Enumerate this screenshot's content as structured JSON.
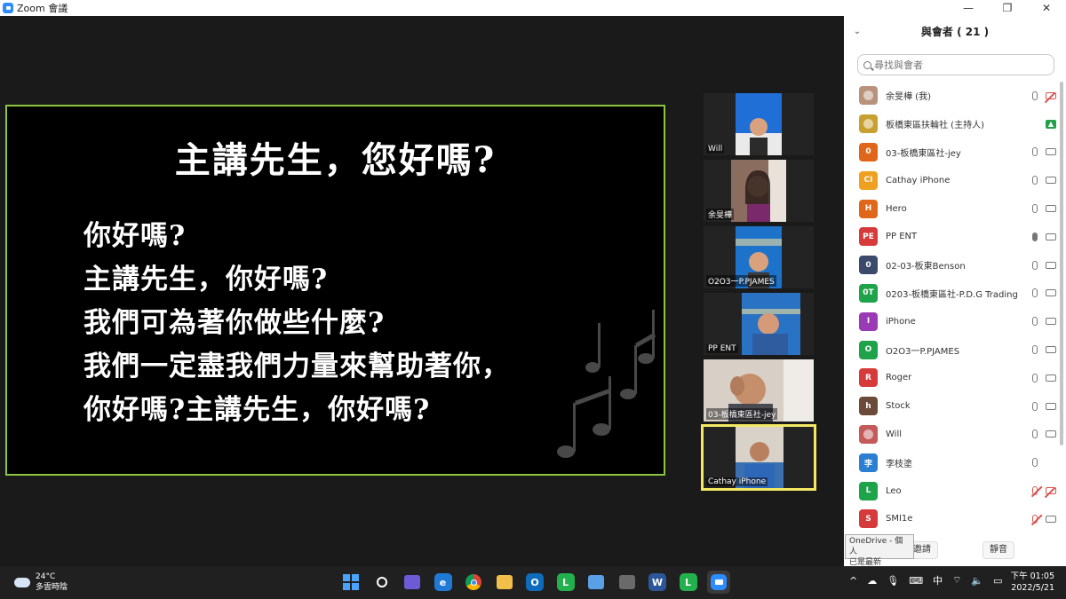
{
  "window": {
    "title": "Zoom 會議",
    "minimize": "—",
    "maximize": "❐",
    "close": "✕"
  },
  "share": {
    "heading": "主講先生，您好嗎?",
    "lines": [
      "你好嗎?",
      "主講先生，你好嗎?",
      "我們可為著你做些什麼?",
      "我們一定盡我們力量來幫助著你，",
      "你好嗎?主講先生，你好嗎?"
    ]
  },
  "tiles": [
    {
      "name": "Will",
      "color": "#1f6fd6"
    },
    {
      "name": "余旻樺",
      "color": "#9b7e6b"
    },
    {
      "name": "O2O3一P.PJAMES",
      "color": "#1d72c9"
    },
    {
      "name": "PP ENT",
      "color": "#2a73c4"
    },
    {
      "name": "03-板橋東區社-jey",
      "color": "#b58a6d"
    },
    {
      "name": "Cathay iPhone",
      "color": "#3a6fb0"
    }
  ],
  "participants_panel": {
    "title": "與會者 ( 21 )",
    "search_placeholder": "尋找與會者",
    "participants": [
      {
        "name": "余旻樺 (我)",
        "avatar": "",
        "color": "#b9927c",
        "mic": "off",
        "cam": "muted"
      },
      {
        "name": "板橋東區扶輪社 (主持人)",
        "avatar": "",
        "color": "#c8a030",
        "mic": "none",
        "cam": "host"
      },
      {
        "name": "03-板橋東區社-jey",
        "avatar": "0",
        "color": "#e0661a",
        "mic": "off",
        "cam": "off"
      },
      {
        "name": "Cathay iPhone",
        "avatar": "CI",
        "color": "#f0a020",
        "mic": "off",
        "cam": "off"
      },
      {
        "name": "Hero",
        "avatar": "H",
        "color": "#e0661a",
        "mic": "off",
        "cam": "off"
      },
      {
        "name": "PP ENT",
        "avatar": "PE",
        "color": "#d63a3a",
        "mic": "on",
        "cam": "off"
      },
      {
        "name": "02-03-板東Benson",
        "avatar": "0",
        "color": "#3b4a6b",
        "mic": "off",
        "cam": "off"
      },
      {
        "name": "0203-板橋東區社-P.D.G Trading",
        "avatar": "0T",
        "color": "#1fa34a",
        "mic": "off",
        "cam": "off"
      },
      {
        "name": "iPhone",
        "avatar": "I",
        "color": "#9b3ab5",
        "mic": "off",
        "cam": "off"
      },
      {
        "name": "O2O3一P.PJAMES",
        "avatar": "O",
        "color": "#1fa34a",
        "mic": "off",
        "cam": "off"
      },
      {
        "name": "Roger",
        "avatar": "R",
        "color": "#d63a3a",
        "mic": "off",
        "cam": "off"
      },
      {
        "name": "Stock",
        "avatar": "h",
        "color": "#6b4a3a",
        "mic": "off",
        "cam": "off"
      },
      {
        "name": "Will",
        "avatar": "",
        "color": "#c45a5a",
        "mic": "off",
        "cam": "off"
      },
      {
        "name": "李枝塗",
        "avatar": "李",
        "color": "#2b7fd1",
        "mic": "off",
        "cam": "none"
      },
      {
        "name": "Leo",
        "avatar": "L",
        "color": "#1fa34a",
        "mic": "muted",
        "cam": "muted"
      },
      {
        "name": "SMI1e",
        "avatar": "S",
        "color": "#d63a3a",
        "mic": "muted",
        "cam": "off"
      }
    ],
    "invite_label": "邀請",
    "mute_all_label": "靜音"
  },
  "tooltip": {
    "line1": "OneDrive - 個人",
    "line2": "已是最新"
  },
  "taskbar": {
    "temperature": "24°C",
    "weather": "多雲時陰",
    "apps": [
      {
        "name": "start",
        "glyph": "",
        "color": "#4aa3ff"
      },
      {
        "name": "search",
        "glyph": "",
        "color": "#202020"
      },
      {
        "name": "chat",
        "glyph": "",
        "color": "#6b5bd6"
      },
      {
        "name": "edge",
        "glyph": "e",
        "color": "#1f7ad6"
      },
      {
        "name": "chrome",
        "glyph": "",
        "color": "#e8b62a"
      },
      {
        "name": "explorer",
        "glyph": "",
        "color": "#f2c04a"
      },
      {
        "name": "outlook",
        "glyph": "O",
        "color": "#0f6cbd"
      },
      {
        "name": "line",
        "glyph": "L",
        "color": "#22b14c"
      },
      {
        "name": "notepad",
        "glyph": "",
        "color": "#5aa0e6"
      },
      {
        "name": "calculator",
        "glyph": "",
        "color": "#6a6a6a"
      },
      {
        "name": "word",
        "glyph": "W",
        "color": "#2b579a"
      },
      {
        "name": "line2",
        "glyph": "L",
        "color": "#22b14c"
      },
      {
        "name": "zoom",
        "glyph": "",
        "color": "#2d8cff"
      }
    ],
    "ime": "中",
    "time": "下午 01:05",
    "date": "2022/5/21"
  }
}
